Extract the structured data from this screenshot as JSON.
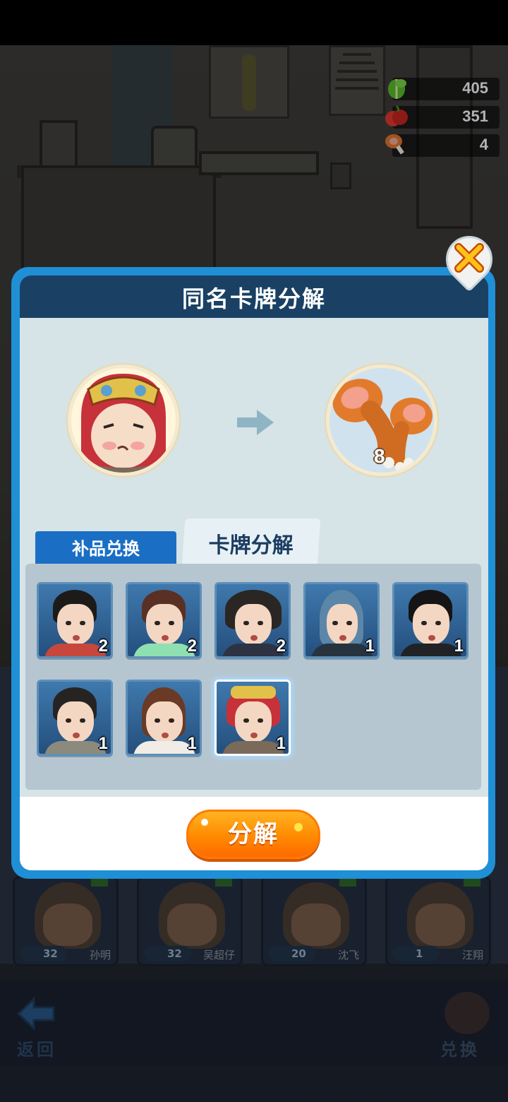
{
  "resources": [
    {
      "icon": "vegetable-icon",
      "value": "405"
    },
    {
      "icon": "fruit-icon",
      "value": "351"
    },
    {
      "icon": "drumstick-icon",
      "value": "4"
    }
  ],
  "background_roster": [
    {
      "level_tag": "初",
      "level": "32",
      "name": "孙明"
    },
    {
      "level_tag": "初",
      "level": "32",
      "name": "吴超仔"
    },
    {
      "level_tag": "初",
      "level": "20",
      "name": "沈飞"
    },
    {
      "level_tag": "初",
      "level": "1",
      "name": "汪翔"
    }
  ],
  "bottom_nav": {
    "back_label": "返回",
    "exchange_label": "兑换"
  },
  "dialog": {
    "title": "同名卡牌分解",
    "close_icon": "close-icon",
    "preview": {
      "source_card": "lion-dance-hat-girl",
      "reward_icon": "drumstick-icon",
      "reward_count": "8"
    },
    "tabs": [
      {
        "label": "补品兑换",
        "active": false
      },
      {
        "label": "卡牌分解",
        "active": true
      }
    ],
    "cards": [
      {
        "id": "short-hair-man",
        "count": "2",
        "selected": false
      },
      {
        "id": "headband-girl",
        "count": "2",
        "selected": false
      },
      {
        "id": "ushanka-boy",
        "count": "2",
        "selected": false
      },
      {
        "id": "blue-hair-girl",
        "count": "1",
        "selected": false
      },
      {
        "id": "slick-hair-man",
        "count": "1",
        "selected": false
      },
      {
        "id": "glasses-reader",
        "count": "1",
        "selected": false
      },
      {
        "id": "long-hair-woman",
        "count": "1",
        "selected": false
      },
      {
        "id": "lion-dance-hat-girl",
        "count": "1",
        "selected": true
      }
    ],
    "action_label": "分解"
  },
  "colors": {
    "dialog_frame": "#1f8fd6",
    "dialog_header": "#1a4064",
    "tab_active": "#e7f1f5",
    "tab_inactive": "#1a6fc4",
    "action_button": "#ff8a00"
  }
}
